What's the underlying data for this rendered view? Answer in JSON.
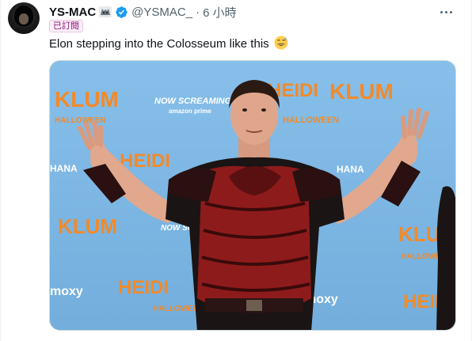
{
  "tweet": {
    "display_name": "YS-MAC",
    "handle": "@YSMAC_",
    "separator": "·",
    "time": "6 小時",
    "subscribed_label": "已訂閱",
    "text": "Elon stepping into the Colosseum like this",
    "emoji_name": "grinning-face-with-sweat-emoji"
  },
  "media": {
    "backdrop_logos": [
      "KLUM",
      "HEIDI",
      "HALLOWEEN",
      "NOW SCREAMING",
      "amazon prime",
      "HANA",
      "moxy"
    ],
    "backdrop_color": "#7fb8e6",
    "logo_color": "#f28a2a"
  },
  "colors": {
    "verified_blue": "#1d9bf0",
    "subscribed_text": "#91107a",
    "secondary_text": "#536471"
  }
}
